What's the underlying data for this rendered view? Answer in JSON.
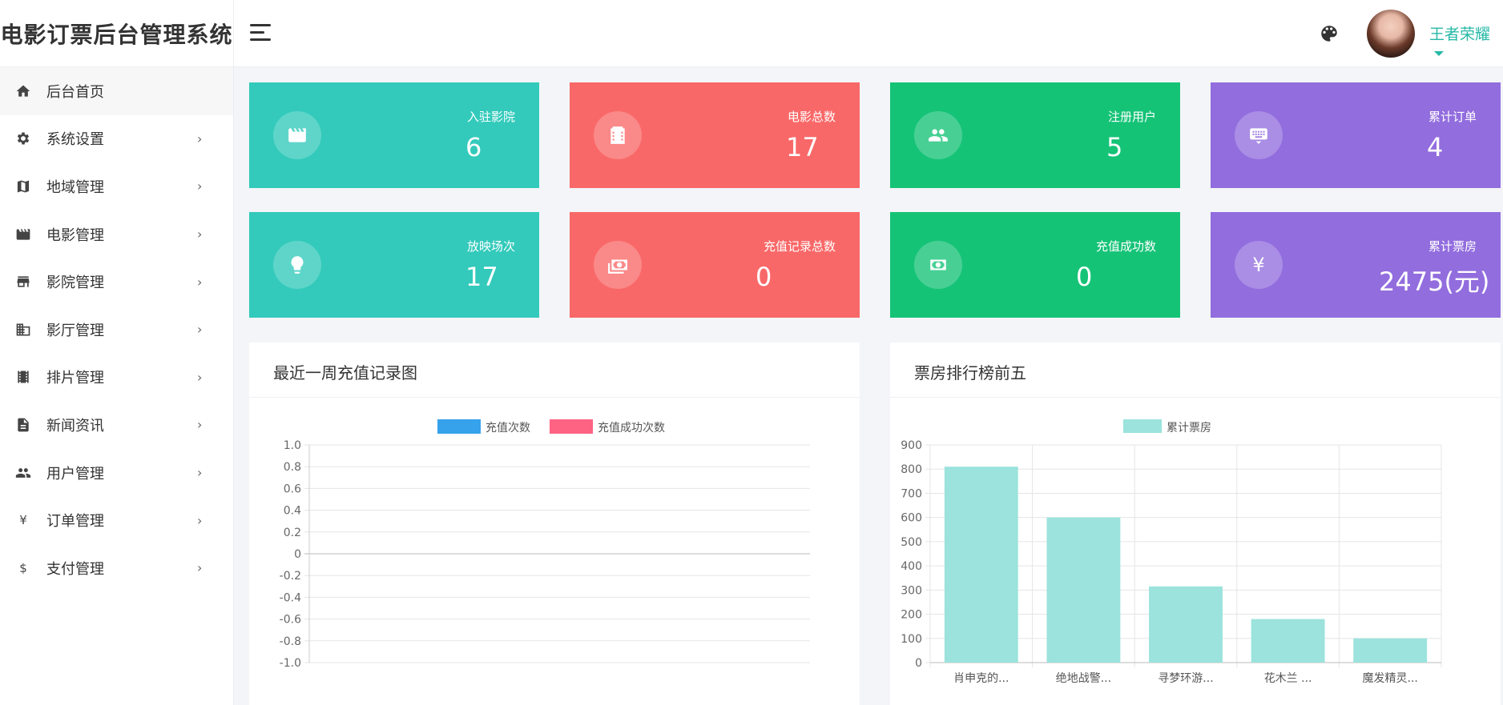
{
  "app": {
    "title": "电影订票后台管理系统"
  },
  "header": {
    "username": "王者荣耀"
  },
  "sidebar": {
    "items": [
      {
        "label": "后台首页",
        "icon": "home-icon",
        "arrow": ""
      },
      {
        "label": "系统设置",
        "icon": "gear-icon",
        "arrow": "›"
      },
      {
        "label": "地域管理",
        "icon": "map-icon",
        "arrow": "›"
      },
      {
        "label": "电影管理",
        "icon": "clapperboard-icon",
        "arrow": "›"
      },
      {
        "label": "影院管理",
        "icon": "store-icon",
        "arrow": "›"
      },
      {
        "label": "影厅管理",
        "icon": "building-icon",
        "arrow": "›"
      },
      {
        "label": "排片管理",
        "icon": "film-strip-icon",
        "arrow": "›"
      },
      {
        "label": "新闻资讯",
        "icon": "news-icon",
        "arrow": "›"
      },
      {
        "label": "用户管理",
        "icon": "users-icon",
        "arrow": "›"
      },
      {
        "label": "订单管理",
        "icon": "yen-icon",
        "arrow": "›"
      },
      {
        "label": "支付管理",
        "icon": "dollar-icon",
        "arrow": "›"
      }
    ]
  },
  "stats": [
    {
      "label": "入驻影院",
      "value": "6",
      "icon": "clapperboard-icon",
      "color": "#33cabb"
    },
    {
      "label": "电影总数",
      "value": "17",
      "icon": "film-icon",
      "color": "#f96868"
    },
    {
      "label": "注册用户",
      "value": "5",
      "icon": "users-icon",
      "color": "#15c377"
    },
    {
      "label": "累计订单",
      "value": "4",
      "icon": "keyboard-icon",
      "color": "#926dde"
    },
    {
      "label": "放映场次",
      "value": "17",
      "icon": "lightbulb-icon",
      "color": "#33cabb"
    },
    {
      "label": "充值记录总数",
      "value": "0",
      "icon": "cash-multiple-icon",
      "color": "#f96868"
    },
    {
      "label": "充值成功数",
      "value": "0",
      "icon": "cash-icon",
      "color": "#15c377"
    },
    {
      "label": "累计票房",
      "value": "2475(元)",
      "icon": "yen-icon",
      "color": "#926dde"
    }
  ],
  "panels": {
    "recharge_title": "最近一周充值记录图",
    "boxoffice_title": "票房排行榜前五"
  },
  "chart_data": [
    {
      "type": "line",
      "title": "最近一周充值记录图",
      "series": [
        {
          "name": "充值次数",
          "values": [],
          "color": "#36a2eb"
        },
        {
          "name": "充值成功次数",
          "values": [],
          "color": "#ff6384"
        }
      ],
      "ylim": [
        -1.0,
        1.0
      ],
      "yticks": [
        "1.0",
        "0.8",
        "0.6",
        "0.4",
        "0.2",
        "0",
        "-0.2",
        "-0.4",
        "-0.6",
        "-0.8",
        "-1.0"
      ],
      "legend": "top",
      "grid": true
    },
    {
      "type": "bar",
      "title": "票房排行榜前五",
      "categories": [
        "肖申克的...",
        "绝地战警...",
        "寻梦环游...",
        "花木兰 ...",
        "魔发精灵..."
      ],
      "series": [
        {
          "name": "累计票房",
          "values": [
            810,
            600,
            315,
            180,
            100
          ],
          "color": "#9be3dc"
        }
      ],
      "ylim": [
        0,
        900
      ],
      "yticks": [
        "900",
        "800",
        "700",
        "600",
        "500",
        "400",
        "300",
        "200",
        "100",
        "0"
      ],
      "legend": "top",
      "grid": true
    }
  ]
}
